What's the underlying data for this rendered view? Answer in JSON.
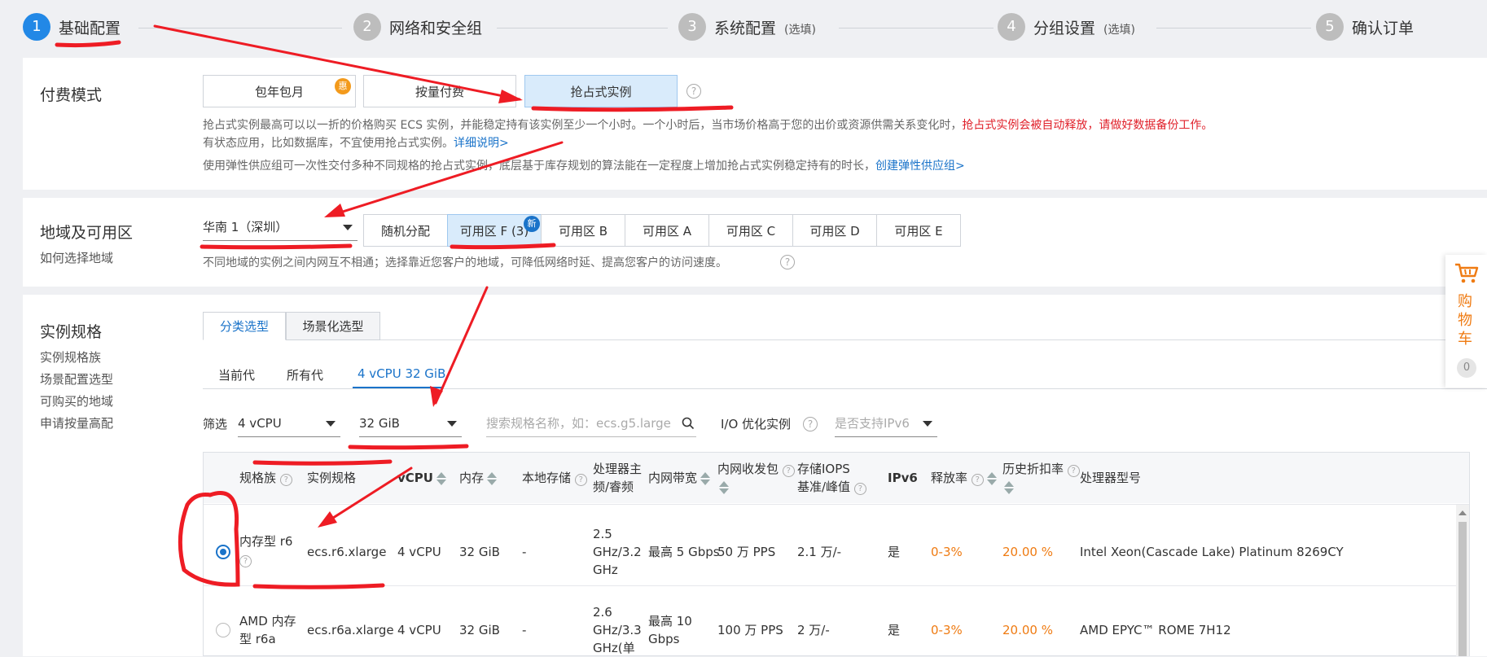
{
  "steps": [
    {
      "num": "1",
      "label": "基础配置",
      "optional": ""
    },
    {
      "num": "2",
      "label": "网络和安全组",
      "optional": ""
    },
    {
      "num": "3",
      "label": "系统配置",
      "optional": "(选填)"
    },
    {
      "num": "4",
      "label": "分组设置",
      "optional": "(选填)"
    },
    {
      "num": "5",
      "label": "确认订单",
      "optional": ""
    }
  ],
  "billing": {
    "title": "付费模式",
    "options": [
      "包年包月",
      "按量付费",
      "抢占式实例"
    ],
    "selected": "抢占式实例",
    "badge": "惠",
    "help": "?",
    "desc_line1": "抢占式实例最高可以以一折的价格购买 ECS 实例，并能稳定持有该实例至少一个小时。一个小时后，当市场价格高于您的出价或资源供需关系变化时，",
    "desc_line1_red": "抢占式实例会被自动释放，请做好数据备份工作。",
    "desc_line2": "有状态应用，比如数据库，不宜使用抢占式实例。",
    "desc_line2_link": "详细说明>",
    "desc_line3": "使用弹性供应组可一次性交付多种不同规格的抢占式实例，底层基于库存规划的算法能在一定程度上增加抢占式实例稳定持有的时长，",
    "desc_line3_link": "创建弹性供应组>"
  },
  "region": {
    "title": "地域及可用区",
    "subtitle": "如何选择地域",
    "selected_region": "华南 1（深圳）",
    "zones": [
      "随机分配",
      "可用区 F (3)",
      "可用区 B",
      "可用区 A",
      "可用区 C",
      "可用区 D",
      "可用区 E"
    ],
    "selected_zone": "可用区 F (3)",
    "new_badge": "新",
    "desc": "不同地域的实例之间内网互不相通；选择靠近您客户的地域，可降低网络时延、提高您客户的访问速度。",
    "help": "?"
  },
  "spec": {
    "title": "实例规格",
    "side_links": [
      "实例规格族",
      "场景配置选型",
      "可购买的地域",
      "申请按量高配"
    ],
    "tabs": [
      "分类选型",
      "场景化选型"
    ],
    "active_tab": "分类选型",
    "gen_tabs": [
      "当前代",
      "所有代",
      "4 vCPU 32 GiB"
    ],
    "active_gen_tab": "4 vCPU 32 GiB",
    "filter_label": "筛选",
    "vcpu": "4 vCPU",
    "memory": "32 GiB",
    "search_placeholder": "搜索规格名称，如：ecs.g5.large",
    "io_label": "I/O 优化实例",
    "ipv6_placeholder": "是否支持IPv6",
    "help": "?",
    "columns": [
      "规格族",
      "实例规格",
      "vCPU",
      "内存",
      "本地存储",
      "处理器主",
      "频/睿频",
      "内网带宽",
      "内网收发包",
      "存储IOPS",
      "基准/峰值",
      "IPv6",
      "释放率",
      "历史折扣率",
      "处理器型号"
    ],
    "rows": [
      {
        "family": "内存型 r6",
        "spec": "ecs.r6.xlarge",
        "vcpu": "4 vCPU",
        "mem": "32 GiB",
        "local": "-",
        "freq1": "2.5",
        "freq2": "GHz/3.2",
        "freq3": "GHz",
        "bw": "最高 5 Gbps",
        "pps": "50 万 PPS",
        "iops": "2.1 万/-",
        "ipv6": "是",
        "release": "0-3%",
        "discount": "20.00 %",
        "cpu": "Intel Xeon(Cascade Lake) Platinum 8269CY"
      },
      {
        "family1": "AMD 内存",
        "family2": "型 r6a",
        "spec": "ecs.r6a.xlarge",
        "vcpu": "4 vCPU",
        "mem": "32 GiB",
        "local": "-",
        "freq1": "2.6",
        "freq2": "GHz/3.3",
        "freq3": "GHz(单",
        "bw1": "最高 10",
        "bw2": "Gbps",
        "pps": "100 万 PPS",
        "iops": "2 万/-",
        "ipv6": "是",
        "release": "0-3%",
        "discount": "20.00 %",
        "cpu": "AMD EPYC™ ROME 7H12"
      }
    ]
  },
  "cart": {
    "chars": [
      "购",
      "物",
      "车"
    ],
    "count": "0"
  }
}
